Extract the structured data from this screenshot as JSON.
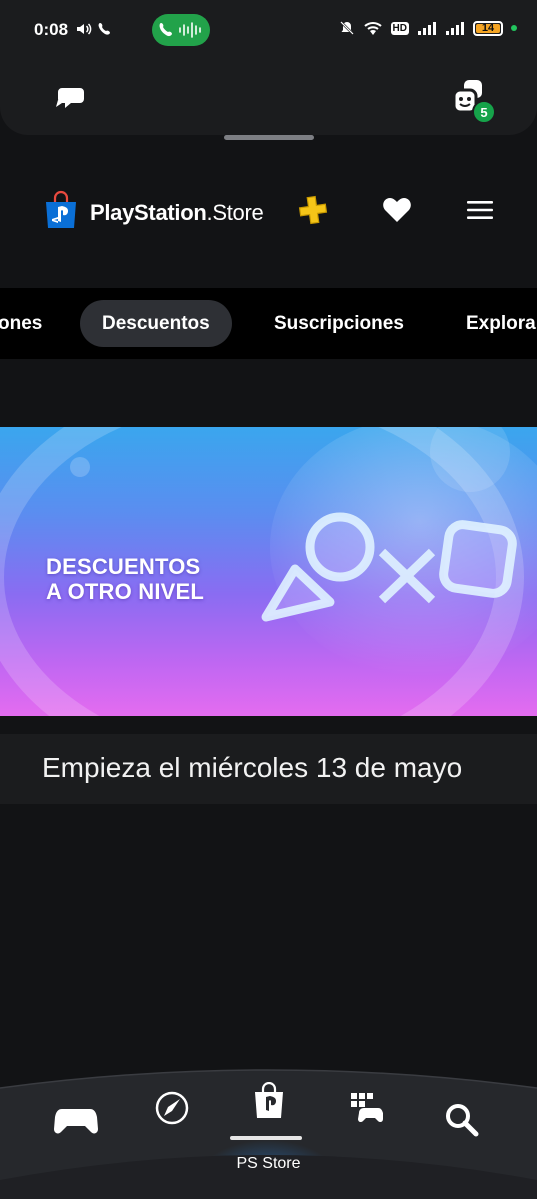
{
  "status_bar": {
    "time": "0:08",
    "battery": "14",
    "hd": "HD"
  },
  "top_panel": {
    "friends_badge_count": "5"
  },
  "header": {
    "brand_bold": "PlayStation",
    "brand_tm": ".",
    "brand_store": "Store"
  },
  "tabs": [
    {
      "label": "ones"
    },
    {
      "label": "Descuentos",
      "active": true
    },
    {
      "label": "Suscripciones"
    },
    {
      "label": "Explora"
    }
  ],
  "banner": {
    "line1": "DESCUENTOS",
    "line2": "A OTRO NIVEL",
    "caption": "Empieza el miércoles 13 de mayo"
  },
  "bottom_nav": {
    "active_label": "PS Store",
    "items": [
      "game-controller-icon",
      "explore-rocket-icon",
      "ps-store-bag-icon",
      "game-library-icon",
      "search-icon"
    ]
  },
  "colors": {
    "background": "#121315",
    "panel": "#1b1c1e",
    "tab_active": "#2e3035",
    "call_green": "#22a24a",
    "badge_green": "#16a34a",
    "ps_plus_gold": "#f5c518",
    "ps_blue": "#0070d1"
  }
}
